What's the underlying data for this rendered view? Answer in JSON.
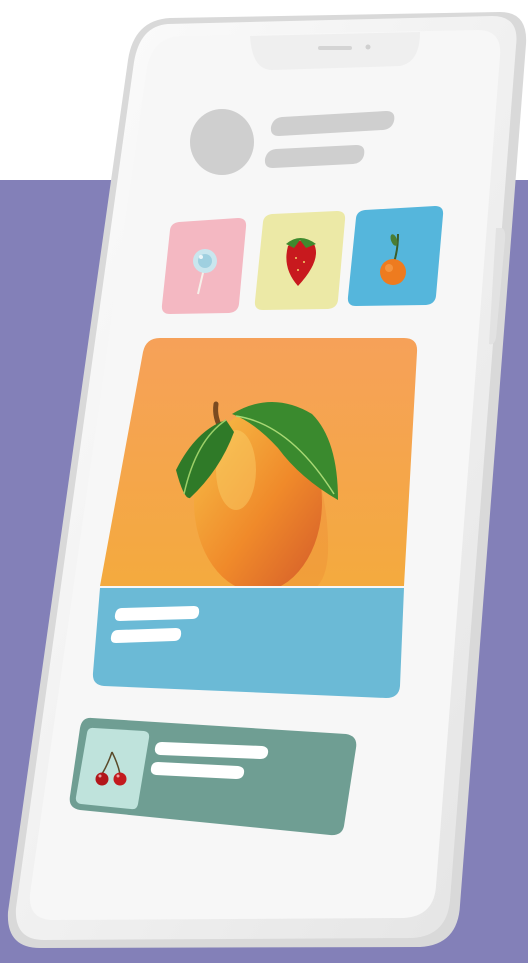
{
  "screen": {
    "avatar": "avatar-placeholder",
    "header_lines": 2
  },
  "thumbnails": [
    {
      "name": "lollipop",
      "icon": "lollipop-icon",
      "bg": "#f4b8c2"
    },
    {
      "name": "strawberry",
      "icon": "strawberry-icon",
      "bg": "#ece9a6"
    },
    {
      "name": "mandarin",
      "icon": "mandarin-icon",
      "bg": "#55b6dc"
    }
  ],
  "featured": {
    "image": "mango-icon",
    "image_bg": "#f5a54a",
    "caption_bg": "#6bbad6"
  },
  "list_item": {
    "image": "cherries-icon",
    "bg": "#6f9e93",
    "thumb_bg": "#bfe3dc"
  },
  "colors": {
    "background_panel": "#8380b8",
    "phone_body": "#f2f2f2",
    "placeholder_gray": "#cfcfcf"
  }
}
